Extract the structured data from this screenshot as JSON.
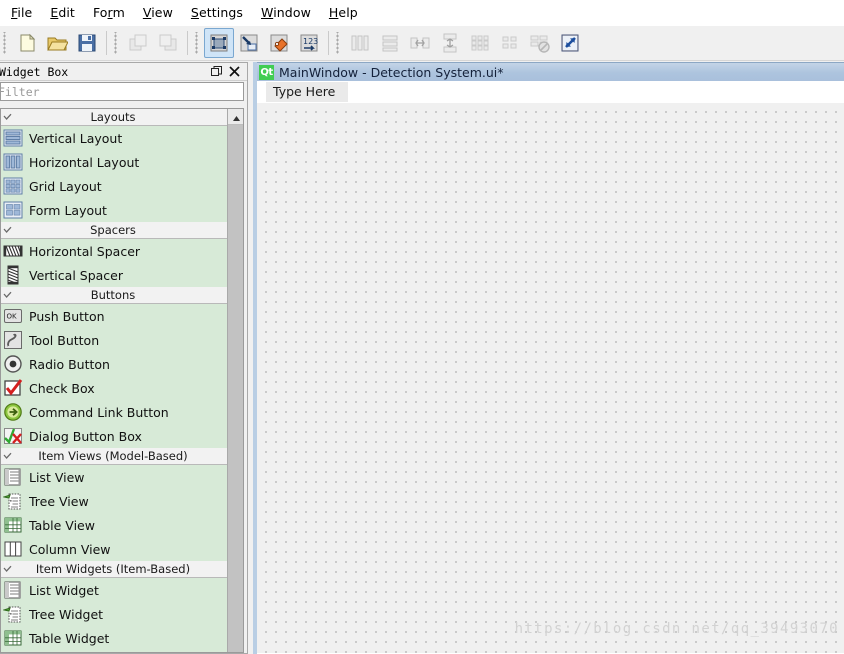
{
  "menubar": {
    "items": [
      {
        "label": "File",
        "mnemonic": "F"
      },
      {
        "label": "Edit",
        "mnemonic": "E"
      },
      {
        "label": "Form",
        "mnemonic": "r"
      },
      {
        "label": "View",
        "mnemonic": "V"
      },
      {
        "label": "Settings",
        "mnemonic": "S"
      },
      {
        "label": "Window",
        "mnemonic": "W"
      },
      {
        "label": "Help",
        "mnemonic": "H"
      }
    ]
  },
  "toolbar": {
    "groups": [
      {
        "buttons": [
          {
            "icon": "new-form-icon",
            "name": "new-button",
            "state": "normal"
          },
          {
            "icon": "open-folder-icon",
            "name": "open-button",
            "state": "normal"
          },
          {
            "icon": "save-floppy-icon",
            "name": "save-button",
            "state": "normal"
          }
        ]
      },
      {
        "buttons": [
          {
            "icon": "undo-icon",
            "name": "undo-button",
            "state": "disabled"
          },
          {
            "icon": "redo-icon",
            "name": "redo-button",
            "state": "disabled"
          }
        ]
      },
      {
        "buttons": [
          {
            "icon": "edit-widgets-icon",
            "name": "edit-widgets-button",
            "state": "checked"
          },
          {
            "icon": "edit-signals-slots-icon",
            "name": "edit-signals-slots-button",
            "state": "normal"
          },
          {
            "icon": "edit-buddies-icon",
            "name": "edit-buddies-button",
            "state": "normal"
          },
          {
            "icon": "edit-tab-order-icon",
            "name": "edit-tab-order-button",
            "state": "normal"
          }
        ]
      },
      {
        "buttons": [
          {
            "icon": "layout-horizontal-icon",
            "name": "layout-horizontally-button",
            "state": "disabled"
          },
          {
            "icon": "layout-vertical-icon",
            "name": "layout-vertically-button",
            "state": "disabled"
          },
          {
            "icon": "layout-splitter-h-icon",
            "name": "layout-splitter-horizontal-button",
            "state": "disabled"
          },
          {
            "icon": "layout-splitter-v-icon",
            "name": "layout-splitter-vertical-button",
            "state": "disabled"
          },
          {
            "icon": "layout-grid-icon",
            "name": "layout-grid-button",
            "state": "disabled"
          },
          {
            "icon": "layout-form-icon",
            "name": "layout-form-button",
            "state": "disabled"
          },
          {
            "icon": "break-layout-icon",
            "name": "break-layout-button",
            "state": "disabled"
          },
          {
            "icon": "adjust-size-icon",
            "name": "adjust-size-button",
            "state": "normal"
          }
        ]
      }
    ]
  },
  "widget_box": {
    "title": "Widget Box",
    "float_button": "undock-icon",
    "close_button": "close-icon",
    "filter": {
      "placeholder": "Filter",
      "value": ""
    },
    "sections": [
      {
        "title": "Layouts",
        "expanded": true,
        "items": [
          {
            "label": "Vertical Layout",
            "icon": "vertical-layout-icon"
          },
          {
            "label": "Horizontal Layout",
            "icon": "horizontal-layout-icon"
          },
          {
            "label": "Grid Layout",
            "icon": "grid-layout-icon"
          },
          {
            "label": "Form Layout",
            "icon": "form-layout-icon"
          }
        ]
      },
      {
        "title": "Spacers",
        "expanded": true,
        "items": [
          {
            "label": "Horizontal Spacer",
            "icon": "horizontal-spacer-icon"
          },
          {
            "label": "Vertical Spacer",
            "icon": "vertical-spacer-icon"
          }
        ]
      },
      {
        "title": "Buttons",
        "expanded": true,
        "items": [
          {
            "label": "Push Button",
            "icon": "push-button-icon"
          },
          {
            "label": "Tool Button",
            "icon": "tool-button-icon"
          },
          {
            "label": "Radio Button",
            "icon": "radio-button-icon"
          },
          {
            "label": "Check Box",
            "icon": "check-box-icon"
          },
          {
            "label": "Command Link Button",
            "icon": "command-link-button-icon"
          },
          {
            "label": "Dialog Button Box",
            "icon": "dialog-button-box-icon"
          }
        ]
      },
      {
        "title": "Item Views (Model-Based)",
        "expanded": true,
        "items": [
          {
            "label": "List View",
            "icon": "list-view-icon"
          },
          {
            "label": "Tree View",
            "icon": "tree-view-icon"
          },
          {
            "label": "Table View",
            "icon": "table-view-icon"
          },
          {
            "label": "Column View",
            "icon": "column-view-icon"
          }
        ]
      },
      {
        "title": "Item Widgets (Item-Based)",
        "expanded": true,
        "items": [
          {
            "label": "List Widget",
            "icon": "list-widget-icon"
          },
          {
            "label": "Tree Widget",
            "icon": "tree-widget-icon"
          },
          {
            "label": "Table Widget",
            "icon": "table-widget-icon"
          }
        ]
      }
    ]
  },
  "form_window": {
    "app_icon": "Qt",
    "title": "MainWindow - Detection System.ui*",
    "menubar_placeholder": "Type Here",
    "watermark": "https://blog.csdn.net/qq_39493070"
  },
  "colors": {
    "list_background": "#d7ead7",
    "category_background": "#f2f2f2",
    "titlebar_accent": "#adc4de",
    "qt_green": "#41cd52",
    "chrome": "#f0f0f0"
  }
}
